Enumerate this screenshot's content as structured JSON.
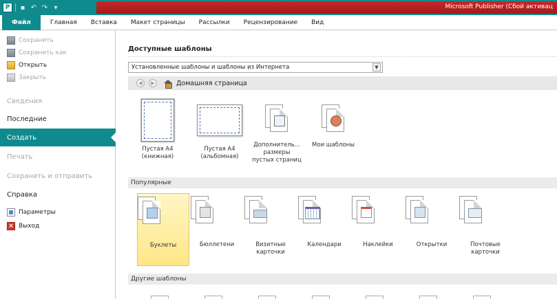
{
  "window": {
    "title": "Microsoft Publisher (Сбой активац"
  },
  "qat": {
    "logo": "P"
  },
  "tabs": [
    "Файл",
    "Главная",
    "Вставка",
    "Макет страницы",
    "Рассылки",
    "Рецензирование",
    "Вид"
  ],
  "backstage": {
    "save": "Сохранить",
    "save_as": "Сохранить как",
    "open": "Открыть",
    "close": "Закрыть",
    "info": "Сведения",
    "recent": "Последние",
    "new": "Создать",
    "print": "Печать",
    "save_send": "Сохранить и отправить",
    "help": "Справка",
    "options": "Параметры",
    "exit": "Выход"
  },
  "main": {
    "title": "Доступные шаблоны",
    "dropdown_value": "Установленные шаблоны и шаблоны из Интернета",
    "nav_home": "Домашняя страница",
    "blank_portrait": [
      "Пустая А4",
      "(книжная)"
    ],
    "blank_landscape": [
      "Пустая А4",
      "(альбомная)"
    ],
    "more_sizes": [
      "Дополнитель...",
      "размеры",
      "пустых страниц"
    ],
    "my_templates": "Мои шаблоны",
    "popular_heading": "Популярные",
    "popular": [
      [
        "Буклеты"
      ],
      [
        "Бюллетени"
      ],
      [
        "Визитные",
        "карточки"
      ],
      [
        "Календари"
      ],
      [
        "Наклейки"
      ],
      [
        "Открытки"
      ],
      [
        "Почтовые",
        "карточки"
      ]
    ],
    "other_heading": "Другие шаблоны"
  },
  "colors": {
    "accent": "#0f8b8d",
    "titlebar_red": "#c62828",
    "selection": "#ffe686"
  }
}
